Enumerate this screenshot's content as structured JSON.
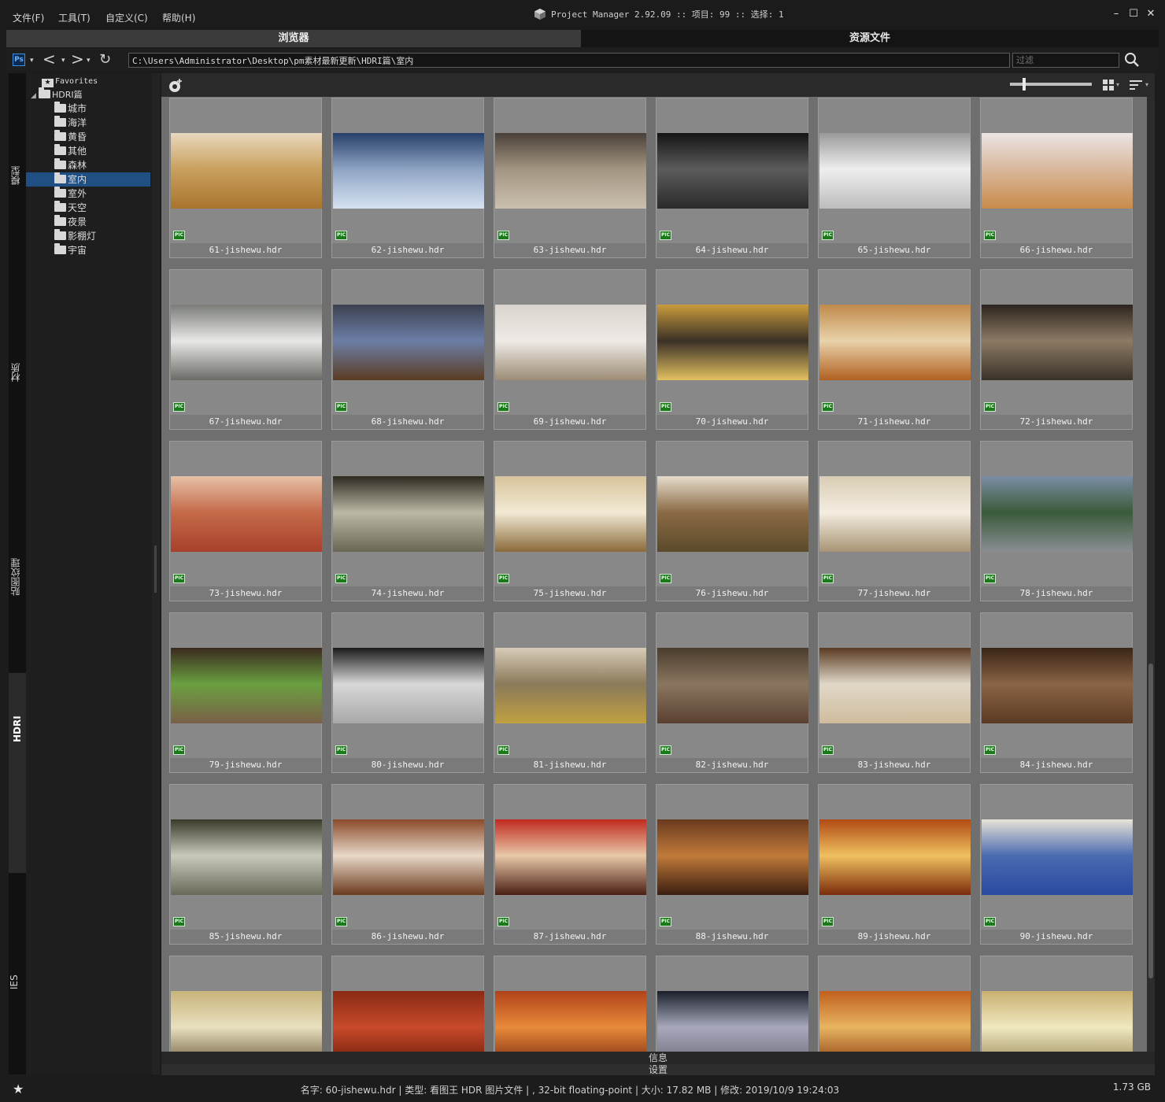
{
  "menu": [
    "文件(F)",
    "工具(T)",
    "自定义(C)",
    "帮助(H)"
  ],
  "app_title": "Project Manager 2.92.09  :: 项目: 99  :: 选择: 1",
  "window_controls": [
    "minimize-icon",
    "maximize-icon",
    "close-icon"
  ],
  "tabs": [
    {
      "label": "浏览器",
      "active": true
    },
    {
      "label": "资源文件",
      "active": false
    }
  ],
  "address": {
    "ps_label": "Ps",
    "path": "C:\\Users\\Administrator\\Desktop\\pm素材最新更新\\HDRI篇\\室内",
    "filter_placeholder": "过滤"
  },
  "side_tabs": [
    {
      "label": "模型",
      "active": false
    },
    {
      "label": "材质",
      "active": false
    },
    {
      "label": "贴图纹理",
      "active": false
    },
    {
      "label": "HDRI",
      "active": true
    },
    {
      "label": "IES",
      "active": false
    }
  ],
  "tree": {
    "favorites": "Favorites",
    "root": "HDRI篇",
    "folders": [
      "城市",
      "海洋",
      "黄昏",
      "其他",
      "森林",
      "室内",
      "室外",
      "天空",
      "夜景",
      "影棚灯",
      "宇宙"
    ],
    "selected": "室内"
  },
  "colors": {
    "selection": "#1f4f83",
    "pic_badge": "#1a7a1a",
    "grid_bg": "#6f6f6f"
  },
  "badge_label": "PIC",
  "files": [
    {
      "name": "61-jishewu.hdr",
      "c1": "#e8d8bd",
      "c2": "#c9a05e",
      "c3": "#a8742e"
    },
    {
      "name": "62-jishewu.hdr",
      "c1": "#27406a",
      "c2": "#8fa4c4",
      "c3": "#d6e2f2"
    },
    {
      "name": "63-jishewu.hdr",
      "c1": "#4a4038",
      "c2": "#a49682",
      "c3": "#cbbfae"
    },
    {
      "name": "64-jishewu.hdr",
      "c1": "#141414",
      "c2": "#5c5c5c",
      "c3": "#2a2a2a"
    },
    {
      "name": "65-jishewu.hdr",
      "c1": "#9a9a9a",
      "c2": "#eeeeee",
      "c3": "#bdbdbd"
    },
    {
      "name": "66-jishewu.hdr",
      "c1": "#ece4e4",
      "c2": "#d8b89c",
      "c3": "#c98a4a"
    },
    {
      "name": "67-jishewu.hdr",
      "c1": "#7a7c78",
      "c2": "#e8e8e6",
      "c3": "#6a6b66"
    },
    {
      "name": "68-jishewu.hdr",
      "c1": "#3c4150",
      "c2": "#6c7ea6",
      "c3": "#5a3c22"
    },
    {
      "name": "69-jishewu.hdr",
      "c1": "#d9d4cc",
      "c2": "#eeeae6",
      "c3": "#9c8c74"
    },
    {
      "name": "70-jishewu.hdr",
      "c1": "#c99c3c",
      "c2": "#3a3026",
      "c3": "#e2c060"
    },
    {
      "name": "71-jishewu.hdr",
      "c1": "#c08a4a",
      "c2": "#e9d2aa",
      "c3": "#b06020"
    },
    {
      "name": "72-jishewu.hdr",
      "c1": "#2c241e",
      "c2": "#8c7a64",
      "c3": "#3a322a"
    },
    {
      "name": "73-jishewu.hdr",
      "c1": "#e6c0a6",
      "c2": "#c46a4a",
      "c3": "#a8402a"
    },
    {
      "name": "74-jishewu.hdr",
      "c1": "#2e2a20",
      "c2": "#bcb8a6",
      "c3": "#6a6654"
    },
    {
      "name": "75-jishewu.hdr",
      "c1": "#d8c49c",
      "c2": "#f2ead4",
      "c3": "#8a6a3a"
    },
    {
      "name": "76-jishewu.hdr",
      "c1": "#e6dccc",
      "c2": "#8a6a44",
      "c3": "#5a4a2a"
    },
    {
      "name": "77-jishewu.hdr",
      "c1": "#d8ccb4",
      "c2": "#f4ede0",
      "c3": "#a89474"
    },
    {
      "name": "78-jishewu.hdr",
      "c1": "#7b8ea4",
      "c2": "#3a5a3a",
      "c3": "#8a8e94"
    },
    {
      "name": "79-jishewu.hdr",
      "c1": "#3a2a1e",
      "c2": "#6aa040",
      "c3": "#7a6048"
    },
    {
      "name": "80-jishewu.hdr",
      "c1": "#1a1a1a",
      "c2": "#d8d8d8",
      "c3": "#a8a8a8"
    },
    {
      "name": "81-jishewu.hdr",
      "c1": "#d8ccb8",
      "c2": "#8a7a5a",
      "c3": "#c0a040"
    },
    {
      "name": "82-jishewu.hdr",
      "c1": "#4a3c2c",
      "c2": "#8a7660",
      "c3": "#5a4030"
    },
    {
      "name": "83-jishewu.hdr",
      "c1": "#5a3a22",
      "c2": "#e0d8c8",
      "c3": "#d0bc9c"
    },
    {
      "name": "84-jishewu.hdr",
      "c1": "#3a2416",
      "c2": "#8a6446",
      "c3": "#5a3a22"
    },
    {
      "name": "85-jishewu.hdr",
      "c1": "#3a3a2a",
      "c2": "#c8c8bc",
      "c3": "#6a6a5a"
    },
    {
      "name": "86-jishewu.hdr",
      "c1": "#8a4a2a",
      "c2": "#e8d8c8",
      "c3": "#6a3a1e"
    },
    {
      "name": "87-jishewu.hdr",
      "c1": "#c02a1e",
      "c2": "#e8c8a8",
      "c3": "#4a1e14"
    },
    {
      "name": "88-jishewu.hdr",
      "c1": "#6a3a1e",
      "c2": "#c07a3a",
      "c3": "#3a1e10"
    },
    {
      "name": "89-jishewu.hdr",
      "c1": "#b04a14",
      "c2": "#f0c060",
      "c3": "#7a2a0a"
    },
    {
      "name": "90-jishewu.hdr",
      "c1": "#e8e4d8",
      "c2": "#4a6ab0",
      "c3": "#2a4aa0"
    },
    {
      "name": "",
      "c1": "#c8b47a",
      "c2": "#e8e0c0",
      "c3": "#6a5a3a"
    },
    {
      "name": "",
      "c1": "#8a2a14",
      "c2": "#c84a2a",
      "c3": "#6a1a0a"
    },
    {
      "name": "",
      "c1": "#b0421a",
      "c2": "#e88a3a",
      "c3": "#7a2a10"
    },
    {
      "name": "",
      "c1": "#1a1e2a",
      "c2": "#a8aabc",
      "c3": "#6a6c7a"
    },
    {
      "name": "",
      "c1": "#c0601e",
      "c2": "#e8b460",
      "c3": "#8a3a10"
    },
    {
      "name": "",
      "c1": "#c8b070",
      "c2": "#f0e8c0",
      "c3": "#9a8a5a"
    }
  ],
  "bottom": {
    "info": "信息",
    "settings": "设置"
  },
  "status": {
    "text": "名字: 60-jishewu.hdr | 类型: 看图王 HDR 图片文件 | , 32-bit floating-point | 大小: 17.82 MB | 修改: 2019/10/9 19:24:03",
    "size": "1.73 GB"
  }
}
